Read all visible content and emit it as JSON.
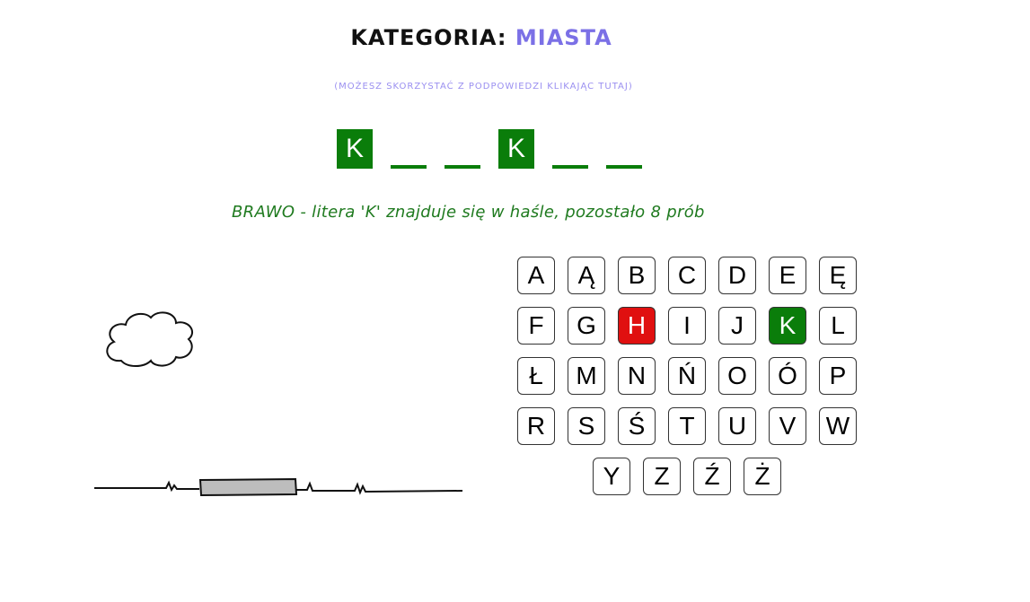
{
  "header": {
    "category_label": "Kategoria:",
    "category_value": "Miasta",
    "hint_text": "(Możesz skorzystać z podpowiedzi klikając tutaj)"
  },
  "word": {
    "slots": [
      {
        "letter": "K",
        "revealed": true
      },
      {
        "letter": "",
        "revealed": false
      },
      {
        "letter": "",
        "revealed": false
      },
      {
        "letter": "K",
        "revealed": true
      },
      {
        "letter": "",
        "revealed": false
      },
      {
        "letter": "",
        "revealed": false
      }
    ],
    "colors": {
      "revealed": "#0a7d0a"
    }
  },
  "message": {
    "text": "BRAWO - litera 'K' znajduje się w haśle, pozostało 8 prób",
    "color": "#1f7a1f"
  },
  "keyboard": {
    "rows": [
      [
        {
          "label": "A",
          "state": "default"
        },
        {
          "label": "Ą",
          "state": "default"
        },
        {
          "label": "B",
          "state": "default"
        },
        {
          "label": "C",
          "state": "default"
        },
        {
          "label": "D",
          "state": "default"
        },
        {
          "label": "E",
          "state": "default"
        },
        {
          "label": "Ę",
          "state": "default"
        }
      ],
      [
        {
          "label": "F",
          "state": "default"
        },
        {
          "label": "G",
          "state": "default"
        },
        {
          "label": "H",
          "state": "wrong"
        },
        {
          "label": "I",
          "state": "default"
        },
        {
          "label": "J",
          "state": "default"
        },
        {
          "label": "K",
          "state": "correct"
        },
        {
          "label": "L",
          "state": "default"
        }
      ],
      [
        {
          "label": "Ł",
          "state": "default"
        },
        {
          "label": "M",
          "state": "default"
        },
        {
          "label": "N",
          "state": "default"
        },
        {
          "label": "Ń",
          "state": "default"
        },
        {
          "label": "O",
          "state": "default"
        },
        {
          "label": "Ó",
          "state": "default"
        },
        {
          "label": "P",
          "state": "default"
        }
      ],
      [
        {
          "label": "R",
          "state": "default"
        },
        {
          "label": "S",
          "state": "default"
        },
        {
          "label": "Ś",
          "state": "default"
        },
        {
          "label": "T",
          "state": "default"
        },
        {
          "label": "U",
          "state": "default"
        },
        {
          "label": "V",
          "state": "default"
        },
        {
          "label": "W",
          "state": "default"
        }
      ],
      [
        {
          "label": "Y",
          "state": "default"
        },
        {
          "label": "Z",
          "state": "default"
        },
        {
          "label": "Ź",
          "state": "default"
        },
        {
          "label": "Ż",
          "state": "default"
        }
      ]
    ],
    "colors": {
      "correct": "#0a7d0a",
      "wrong": "#e01010"
    }
  },
  "scene": {
    "icons": [
      "cloud-icon",
      "ground-line",
      "wooden-plank"
    ]
  }
}
